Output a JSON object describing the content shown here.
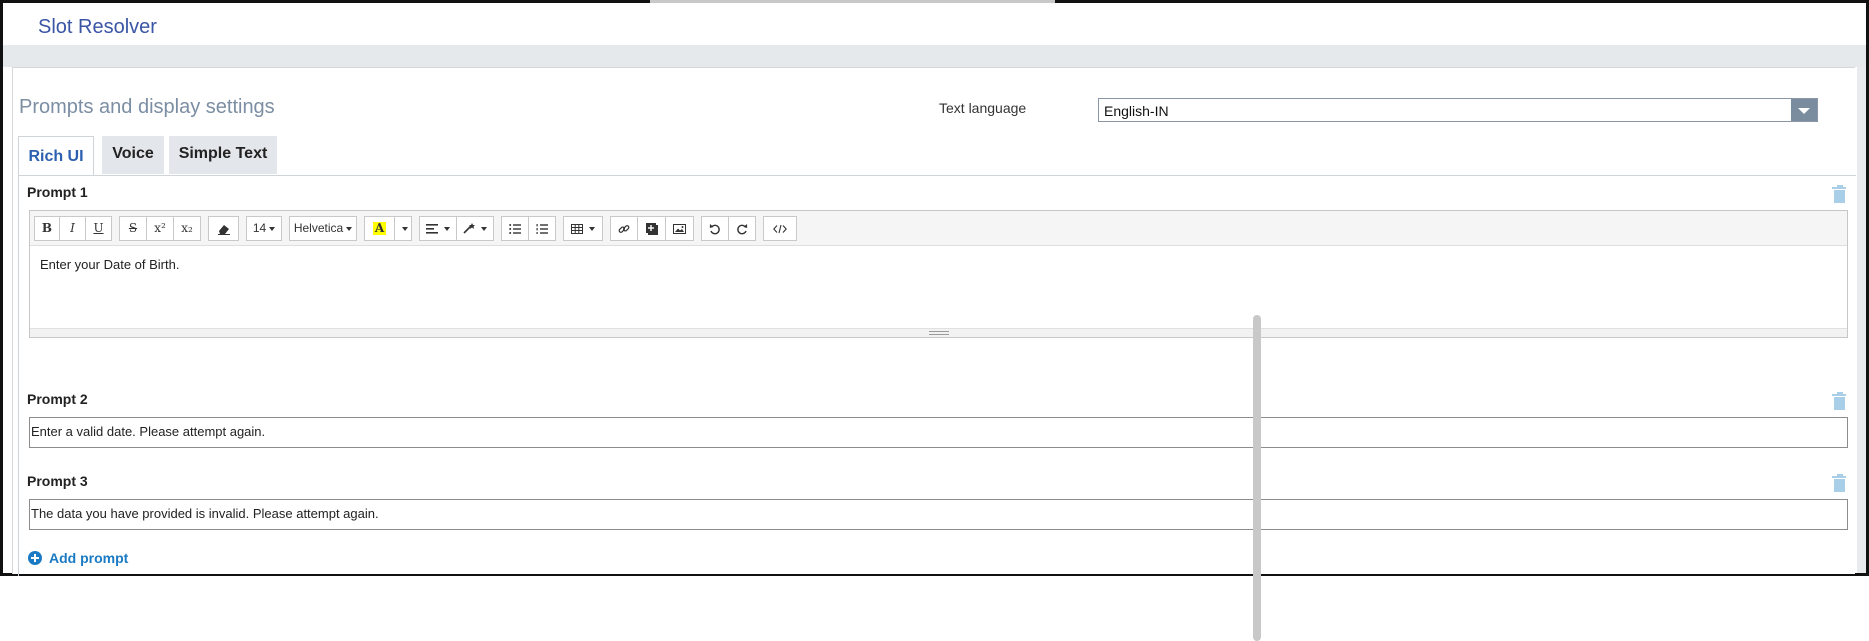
{
  "app": {
    "title": "Slot Resolver"
  },
  "settings": {
    "title": "Prompts and display settings",
    "text_language_label": "Text language",
    "text_language_value": "English-IN"
  },
  "tabs": [
    {
      "label": "Rich UI",
      "active": true
    },
    {
      "label": "Voice",
      "active": false
    },
    {
      "label": "Simple Text",
      "active": false
    }
  ],
  "toolbar": {
    "bold": "B",
    "italic": "I",
    "underline": "U",
    "strikethrough": "S",
    "superscript": "x²",
    "subscript": "x₂",
    "font_size": "14",
    "font_family": "Helvetica",
    "highlight": "A"
  },
  "prompts": [
    {
      "label": "Prompt 1",
      "value": "Enter your Date of Birth."
    },
    {
      "label": "Prompt 2",
      "value": "Enter a valid date. Please attempt again."
    },
    {
      "label": "Prompt 3",
      "value": "The data you have provided is invalid. Please attempt again."
    }
  ],
  "add_prompt_label": "Add prompt",
  "colors": {
    "accent": "#1a7ac3",
    "title": "#3a55a6",
    "section_title": "#7b8ea3",
    "highlight": "#ffff00"
  }
}
